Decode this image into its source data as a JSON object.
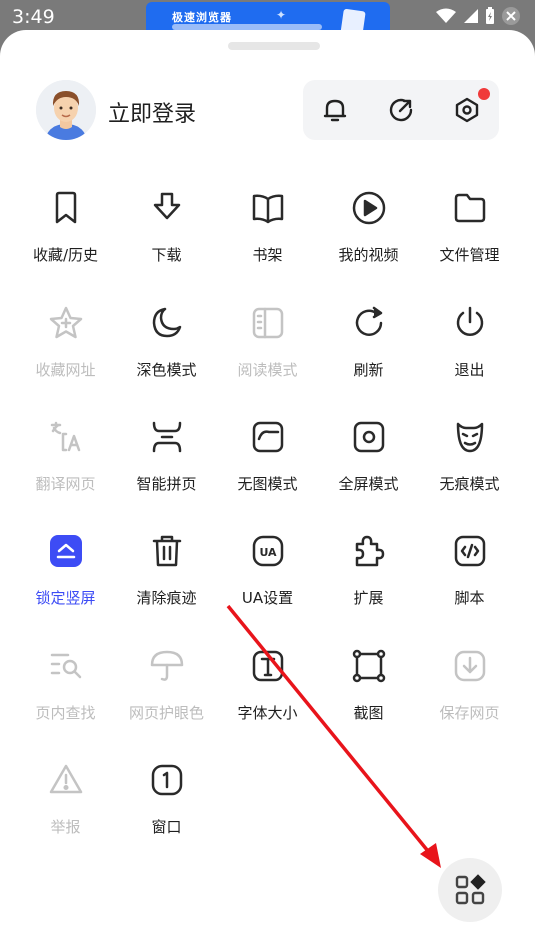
{
  "status": {
    "time": "3:49"
  },
  "banner": {
    "title": "极速浏览器"
  },
  "header": {
    "login": "立即登录",
    "icons": [
      "bell-icon",
      "share-icon",
      "settings-icon"
    ]
  },
  "menu": [
    {
      "label": "收藏/历史",
      "icon": "bookmark-icon",
      "state": "normal"
    },
    {
      "label": "下载",
      "icon": "download-icon",
      "state": "normal"
    },
    {
      "label": "书架",
      "icon": "book-icon",
      "state": "normal"
    },
    {
      "label": "我的视频",
      "icon": "play-icon",
      "state": "normal"
    },
    {
      "label": "文件管理",
      "icon": "folder-icon",
      "state": "normal"
    },
    {
      "label": "收藏网址",
      "icon": "star-add-icon",
      "state": "disabled"
    },
    {
      "label": "深色模式",
      "icon": "moon-icon",
      "state": "normal"
    },
    {
      "label": "阅读模式",
      "icon": "reader-icon",
      "state": "disabled"
    },
    {
      "label": "刷新",
      "icon": "refresh-icon",
      "state": "normal"
    },
    {
      "label": "退出",
      "icon": "power-icon",
      "state": "normal"
    },
    {
      "label": "翻译网页",
      "icon": "translate-icon",
      "state": "disabled"
    },
    {
      "label": "智能拼页",
      "icon": "merge-page-icon",
      "state": "normal"
    },
    {
      "label": "无图模式",
      "icon": "no-image-icon",
      "state": "normal"
    },
    {
      "label": "全屏模式",
      "icon": "fullscreen-icon",
      "state": "normal"
    },
    {
      "label": "无痕模式",
      "icon": "incognito-icon",
      "state": "normal"
    },
    {
      "label": "锁定竖屏",
      "icon": "lock-portrait-icon",
      "state": "active"
    },
    {
      "label": "清除痕迹",
      "icon": "trash-icon",
      "state": "normal"
    },
    {
      "label": "UA设置",
      "icon": "ua-icon",
      "state": "normal"
    },
    {
      "label": "扩展",
      "icon": "puzzle-icon",
      "state": "normal"
    },
    {
      "label": "脚本",
      "icon": "script-icon",
      "state": "normal"
    },
    {
      "label": "页内查找",
      "icon": "find-icon",
      "state": "disabled"
    },
    {
      "label": "网页护眼色",
      "icon": "umbrella-icon",
      "state": "disabled"
    },
    {
      "label": "字体大小",
      "icon": "font-size-icon",
      "state": "normal"
    },
    {
      "label": "截图",
      "icon": "screenshot-icon",
      "state": "normal"
    },
    {
      "label": "保存网页",
      "icon": "save-page-icon",
      "state": "disabled"
    },
    {
      "label": "举报",
      "icon": "warning-icon",
      "state": "disabled"
    },
    {
      "label": "窗口",
      "icon": "window-icon",
      "state": "normal"
    }
  ],
  "colors": {
    "accent": "#3d4cf5",
    "annotation": "#e8141b",
    "badge": "#f03a3a"
  }
}
